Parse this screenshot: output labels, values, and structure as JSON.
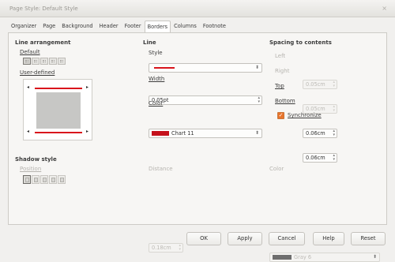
{
  "window": {
    "title": "Page Style: Default Style",
    "close_glyph": "×"
  },
  "tabs": [
    {
      "label": "Organizer",
      "active": false
    },
    {
      "label": "Page",
      "active": false
    },
    {
      "label": "Background",
      "active": false
    },
    {
      "label": "Header",
      "active": false
    },
    {
      "label": "Footer",
      "active": false
    },
    {
      "label": "Borders",
      "active": true
    },
    {
      "label": "Columns",
      "active": false
    },
    {
      "label": "Footnote",
      "active": false
    }
  ],
  "line_arrangement": {
    "heading": "Line arrangement",
    "default_label": "Default",
    "user_defined_label": "User-defined",
    "preset_count": 5,
    "line_color": "#d9141c"
  },
  "line": {
    "heading": "Line",
    "style_label": "Style",
    "width_label": "Width",
    "width_value": "0.05pt",
    "color_label": "Color",
    "color_value": "Chart 11",
    "color_swatch": "#c5111b"
  },
  "spacing": {
    "heading": "Spacing to contents",
    "left_label": "Left",
    "left_value": "0.05cm",
    "right_label": "Right",
    "right_value": "0.05cm",
    "top_label": "Top",
    "top_value": "0.06cm",
    "bottom_label": "Bottom",
    "bottom_value": "0.06cm",
    "synchronize_label": "Synchronize",
    "synchronize_checked": true
  },
  "shadow": {
    "heading": "Shadow style",
    "position_label": "Position",
    "distance_label": "Distance",
    "distance_value": "0.18cm",
    "color_label": "Color",
    "color_value": "Gray 6",
    "color_swatch": "#6e6e6e"
  },
  "buttons": {
    "ok": "OK",
    "apply": "Apply",
    "cancel": "Cancel",
    "help": "Help",
    "reset": "Reset"
  }
}
